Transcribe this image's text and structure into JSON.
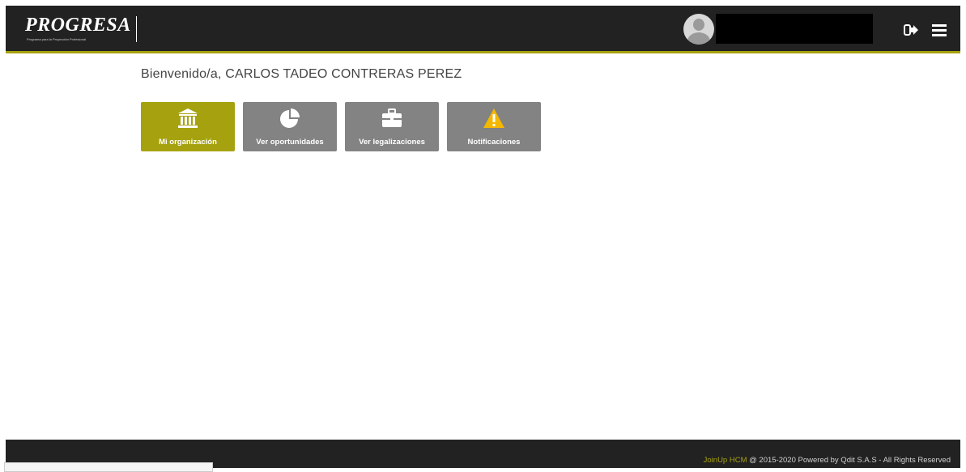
{
  "header": {
    "logo_text": "PROGRESA",
    "logo_tagline": "Programa para la Proyección Profesional",
    "logout_icon": "sign-out-icon",
    "menu_icon": "hamburger-menu-icon"
  },
  "welcome": "Bienvenido/a, CARLOS TADEO CONTRERAS PEREZ",
  "tiles": [
    {
      "label": "Mi organización",
      "icon": "institution-icon",
      "active": true
    },
    {
      "label": "Ver oportunidades",
      "icon": "pie-chart-icon",
      "active": false
    },
    {
      "label": "Ver legalizaciones",
      "icon": "briefcase-icon",
      "active": false
    },
    {
      "label": "Notificaciones",
      "icon": "warning-icon",
      "active": false
    }
  ],
  "footer": {
    "brand": "JoinUp HCM",
    "copyright": " @ 2015-2020 Powered by Qdit S.A.S",
    "separator": " - ",
    "rights": "All Rights Reserved"
  },
  "colors": {
    "topbar": "#222222",
    "accent": "#a6a20f",
    "tile": "#838383",
    "warning": "#f5b800"
  }
}
